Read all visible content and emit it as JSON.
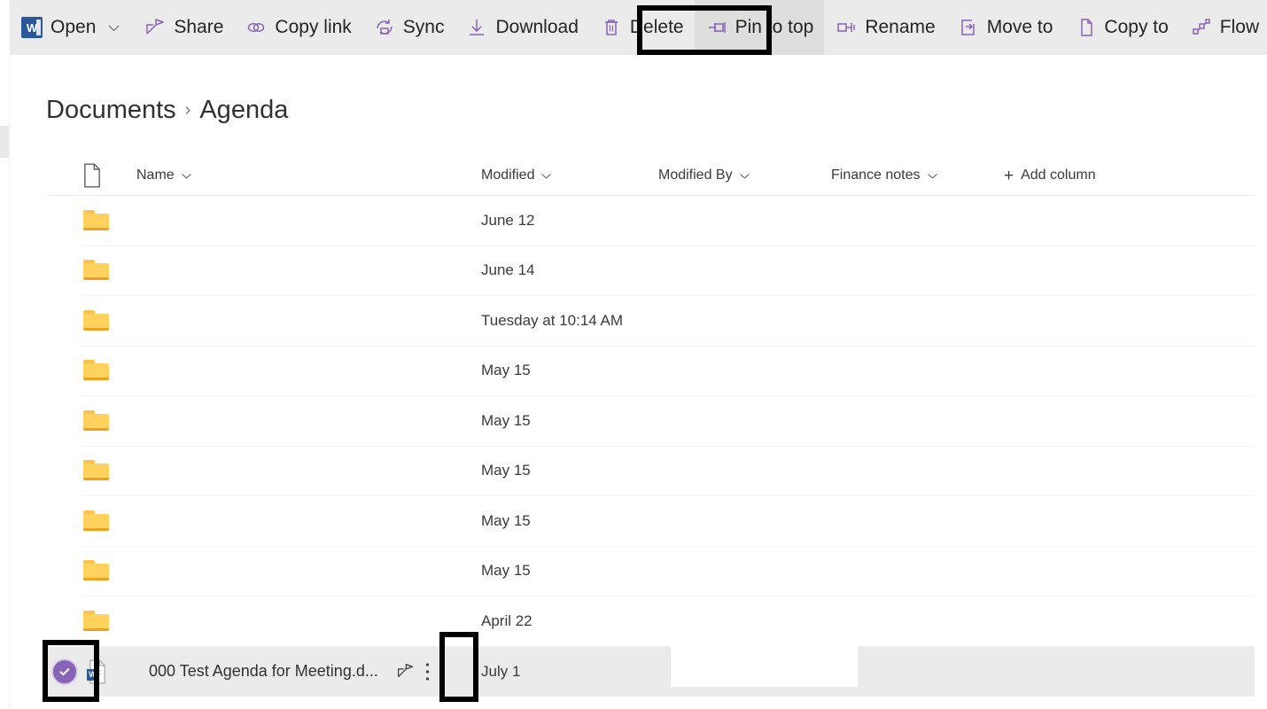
{
  "toolbar": {
    "items": [
      {
        "label": "Open",
        "icon": "word-document-icon",
        "chevron": true
      },
      {
        "label": "Share",
        "icon": "share-icon",
        "chevron": false
      },
      {
        "label": "Copy link",
        "icon": "link-icon",
        "chevron": false
      },
      {
        "label": "Sync",
        "icon": "sync-icon",
        "chevron": false
      },
      {
        "label": "Download",
        "icon": "download-icon",
        "chevron": false
      },
      {
        "label": "Delete",
        "icon": "trash-icon",
        "chevron": false
      },
      {
        "label": "Pin to top",
        "icon": "pin-icon",
        "chevron": false
      },
      {
        "label": "Rename",
        "icon": "rename-icon",
        "chevron": false
      },
      {
        "label": "Move to",
        "icon": "move-to-icon",
        "chevron": false
      },
      {
        "label": "Copy to",
        "icon": "copy-to-icon",
        "chevron": false
      },
      {
        "label": "Flow",
        "icon": "flow-icon",
        "chevron": true
      }
    ],
    "overflow_label": "···",
    "highlighted_item": "Pin to top",
    "background": "#ebebeb",
    "icon_color": "#8764b8"
  },
  "breadcrumb": {
    "root": "Documents",
    "separator": "›",
    "current": "Agenda"
  },
  "list": {
    "columns": [
      {
        "label": "Name",
        "sortable": true
      },
      {
        "label": "Modified",
        "sortable": true
      },
      {
        "label": "Modified By",
        "sortable": true
      },
      {
        "label": "Finance notes",
        "sortable": true
      }
    ],
    "add_column_label": "Add column",
    "add_column_icon": "plus-icon",
    "file_type_header_icon": "file-icon",
    "rows": [
      {
        "type": "folder",
        "icon": "folder-icon",
        "name": "",
        "modified": "June 12",
        "modified_by": "",
        "finance_notes": "",
        "selected": false
      },
      {
        "type": "folder",
        "icon": "folder-icon",
        "name": "",
        "modified": "June 14",
        "modified_by": "",
        "finance_notes": "",
        "selected": false
      },
      {
        "type": "folder",
        "icon": "folder-icon",
        "name": "",
        "modified": "Tuesday at 10:14 AM",
        "modified_by": "",
        "finance_notes": "",
        "selected": false
      },
      {
        "type": "folder",
        "icon": "folder-icon",
        "name": "",
        "modified": "May 15",
        "modified_by": "",
        "finance_notes": "",
        "selected": false
      },
      {
        "type": "folder",
        "icon": "folder-icon",
        "name": "",
        "modified": "May 15",
        "modified_by": "",
        "finance_notes": "",
        "selected": false
      },
      {
        "type": "folder",
        "icon": "folder-icon",
        "name": "",
        "modified": "May 15",
        "modified_by": "",
        "finance_notes": "",
        "selected": false
      },
      {
        "type": "folder",
        "icon": "folder-icon",
        "name": "",
        "modified": "May 15",
        "modified_by": "",
        "finance_notes": "",
        "selected": false
      },
      {
        "type": "folder",
        "icon": "folder-icon",
        "name": "",
        "modified": "May 15",
        "modified_by": "",
        "finance_notes": "",
        "selected": false
      },
      {
        "type": "folder",
        "icon": "folder-icon",
        "name": "",
        "modified": "April 22",
        "modified_by": "",
        "finance_notes": "",
        "selected": false
      },
      {
        "type": "file",
        "icon": "word-file-icon",
        "name": "000 Test Agenda for Meeting.d...",
        "modified": "July 1",
        "modified_by": "",
        "finance_notes": "",
        "selected": true,
        "share_icon": "share-icon",
        "more_icon": "more-vertical-icon",
        "checkbox_icon": "checkmark-circle-icon"
      }
    ]
  },
  "colors": {
    "accent_purple": "#8764b8",
    "folder_yellow": "#ffd25e",
    "word_blue": "#2b579a",
    "selected_row_bg": "#ebebeb",
    "annotation_outline": "#000000"
  }
}
